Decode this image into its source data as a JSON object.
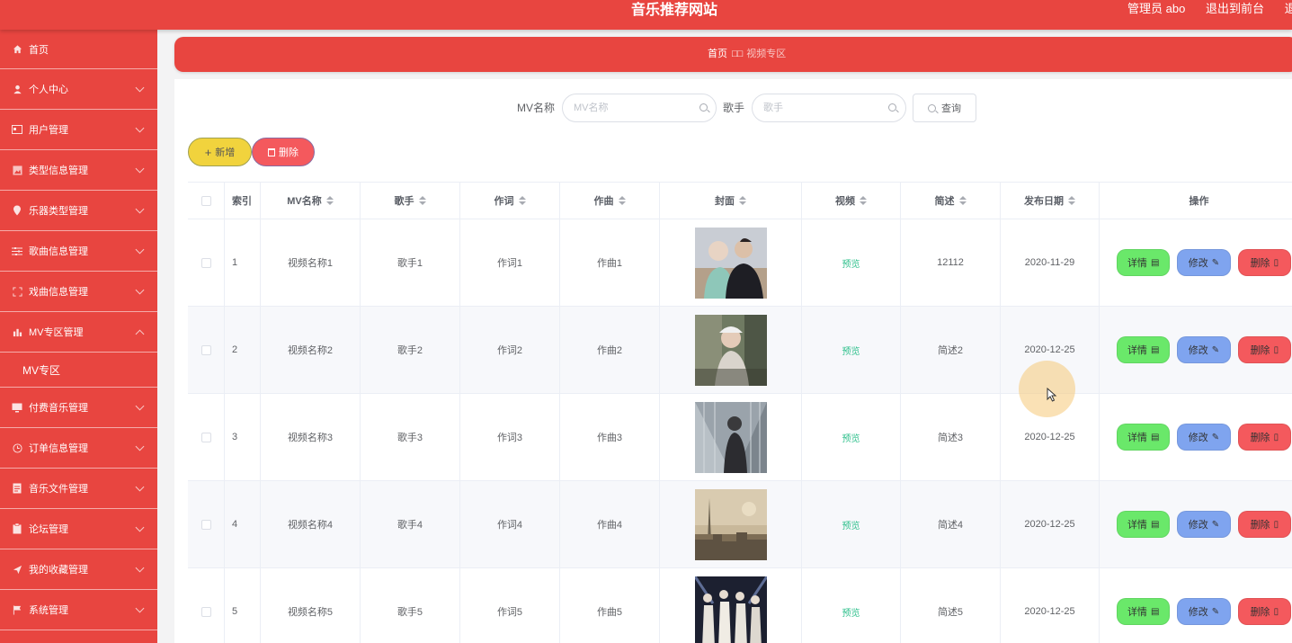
{
  "header": {
    "title": "音乐推荐网站",
    "user": "管理员 abo",
    "to_front": "退出到前台",
    "logout": "退出"
  },
  "sidebar": {
    "items": [
      {
        "label": "首页",
        "icon": "home-icon",
        "chev": false
      },
      {
        "label": "个人中心",
        "icon": "user-icon",
        "chev": true
      },
      {
        "label": "用户管理",
        "icon": "id-card-icon",
        "chev": true
      },
      {
        "label": "类型信息管理",
        "icon": "picture-icon",
        "chev": true
      },
      {
        "label": "乐器类型管理",
        "icon": "location-icon",
        "chev": true
      },
      {
        "label": "歌曲信息管理",
        "icon": "sliders-icon",
        "chev": true
      },
      {
        "label": "戏曲信息管理",
        "icon": "fullscreen-icon",
        "chev": true
      },
      {
        "label": "MV专区管理",
        "icon": "bar-chart-icon",
        "chev": true,
        "open": true
      },
      {
        "label": "MV专区",
        "sub": true
      },
      {
        "label": "付费音乐管理",
        "icon": "monitor-icon",
        "chev": true
      },
      {
        "label": "订单信息管理",
        "icon": "clock-icon",
        "chev": true
      },
      {
        "label": "音乐文件管理",
        "icon": "document-icon",
        "chev": true
      },
      {
        "label": "论坛管理",
        "icon": "clipboard-icon",
        "chev": true
      },
      {
        "label": "我的收藏管理",
        "icon": "send-icon",
        "chev": true
      },
      {
        "label": "系统管理",
        "icon": "flag-icon",
        "chev": true
      }
    ]
  },
  "breadcrumb": {
    "home": "首页",
    "sep": "□□",
    "current": "视频专区"
  },
  "search": {
    "name_label": "MV名称",
    "name_placeholder": "MV名称",
    "singer_label": "歌手",
    "singer_placeholder": "歌手",
    "query_label": "查询"
  },
  "actions": {
    "add_label": "新增",
    "delete_label": "删除"
  },
  "table": {
    "headers": {
      "index": "索引",
      "name": "MV名称",
      "singer": "歌手",
      "lyricist": "作词",
      "composer": "作曲",
      "cover": "封面",
      "video": "视频",
      "desc": "简述",
      "date": "发布日期",
      "ops": "操作"
    },
    "rows": [
      {
        "index": "1",
        "name": "视频名称1",
        "singer": "歌手1",
        "lyricist": "作词1",
        "composer": "作曲1",
        "video": "预览",
        "desc": "12112",
        "date": "2020-11-29"
      },
      {
        "index": "2",
        "name": "视频名称2",
        "singer": "歌手2",
        "lyricist": "作词2",
        "composer": "作曲2",
        "video": "预览",
        "desc": "简述2",
        "date": "2020-12-25"
      },
      {
        "index": "3",
        "name": "视频名称3",
        "singer": "歌手3",
        "lyricist": "作词3",
        "composer": "作曲3",
        "video": "预览",
        "desc": "简述3",
        "date": "2020-12-25"
      },
      {
        "index": "4",
        "name": "视频名称4",
        "singer": "歌手4",
        "lyricist": "作词4",
        "composer": "作曲4",
        "video": "预览",
        "desc": "简述4",
        "date": "2020-12-25"
      },
      {
        "index": "5",
        "name": "视频名称5",
        "singer": "歌手5",
        "lyricist": "作词5",
        "composer": "作曲5",
        "video": "预览",
        "desc": "简述5",
        "date": "2020-12-25"
      }
    ],
    "row_actions": {
      "detail": "详情",
      "edit": "修改",
      "remove": "删除"
    }
  },
  "colors": {
    "primary": "#e84540",
    "detail": "#6ae86a",
    "edit": "#7fa4ef",
    "remove": "#f4595d",
    "add": "#f1d33d",
    "preview": "#2bbf8a"
  }
}
